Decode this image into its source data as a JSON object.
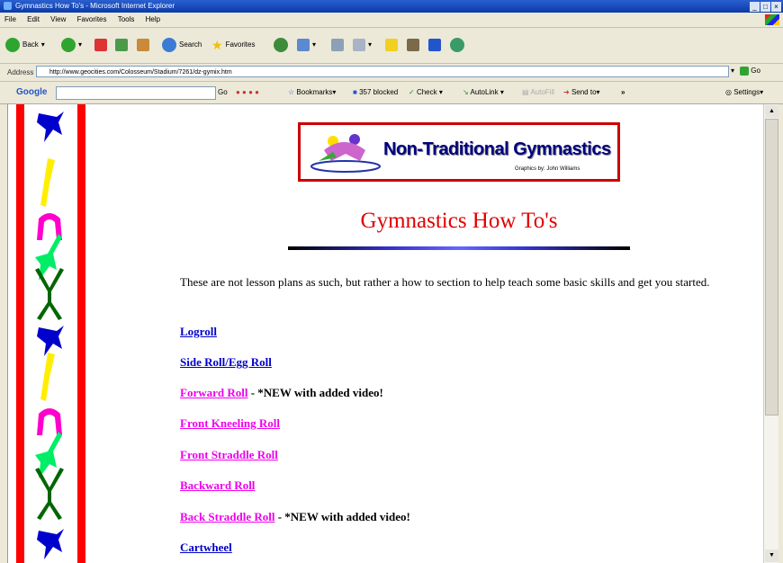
{
  "window": {
    "title": "Gymnastics How To's - Microsoft Internet Explorer",
    "controls": [
      "_",
      "□",
      "×"
    ]
  },
  "menu": [
    "File",
    "Edit",
    "View",
    "Favorites",
    "Tools",
    "Help"
  ],
  "toolbar": {
    "back_label": "Back",
    "search_label": "Search",
    "favorites_label": "Favorites"
  },
  "address": {
    "label": "Address",
    "url": "http://www.geocities.com/Colosseum/Stadium/7261/dz-gymix.htm",
    "go_label": "Go"
  },
  "googlebar": {
    "logo": "Google",
    "go_label": "Go",
    "bookmarks_label": "Bookmarks▾",
    "blocked_label": "357 blocked",
    "check_label": "Check ▾",
    "autolink_label": "AutoLink ▾",
    "autofill_label": "AutoFill",
    "sendto_label": "Send to▾",
    "settings_label": "Settings▾"
  },
  "page": {
    "banner_title": "Non-Traditional Gymnastics",
    "banner_credit": "Graphics by: John Williams",
    "heading": "Gymnastics How To's",
    "intro": "These are not lesson plans as such, but rather a how to section to help teach some basic skills and get you started.",
    "links": [
      {
        "label": "Logroll",
        "note": "",
        "color": "#0000cc"
      },
      {
        "label": "Side Roll/Egg Roll",
        "note": "",
        "color": "#0000cc"
      },
      {
        "label": "Forward Roll",
        "note": " - *NEW with added video!",
        "color": "#ee00ee"
      },
      {
        "label": "Front Kneeling Roll",
        "note": "",
        "color": "#ee00ee"
      },
      {
        "label": "Front Straddle Roll",
        "note": "",
        "color": "#ee00ee"
      },
      {
        "label": "Backward Roll",
        "note": "",
        "color": "#ee00ee"
      },
      {
        "label": "Back Straddle Roll",
        "note": " - *NEW with added video!",
        "color": "#ee00ee"
      },
      {
        "label": "Cartwheel",
        "note": "",
        "color": "#0000cc"
      }
    ]
  }
}
